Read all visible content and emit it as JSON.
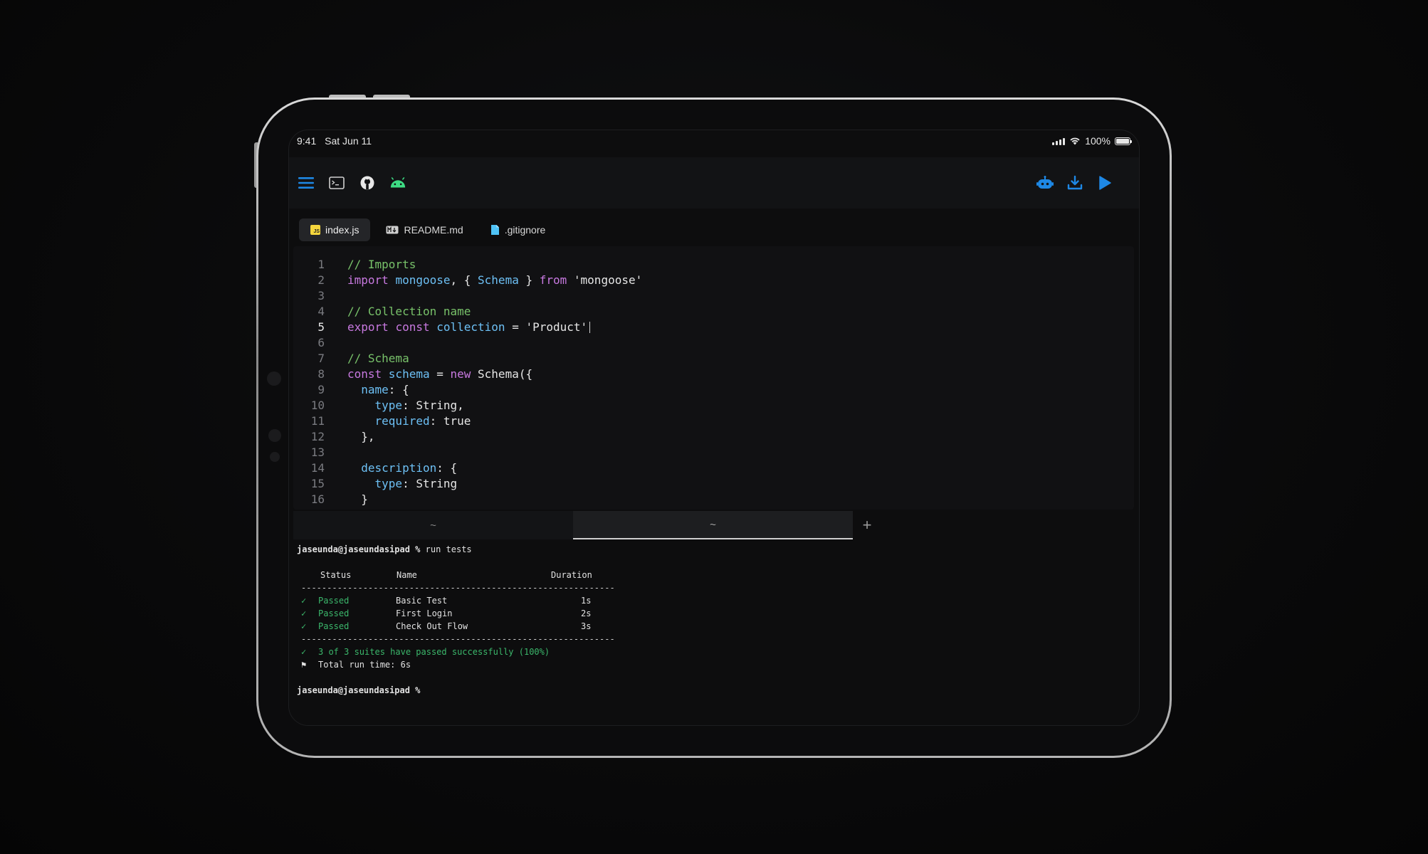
{
  "status_bar": {
    "time": "9:41",
    "date": "Sat Jun 11",
    "battery": "100%"
  },
  "toolbar": {
    "left_icons": [
      "menu-icon",
      "terminal-icon",
      "github-icon",
      "android-icon"
    ],
    "right_icons": [
      "robot-icon",
      "download-icon",
      "play-icon"
    ],
    "accent": "#1e88e5",
    "android_color": "#3ddc84"
  },
  "tabs": [
    {
      "label": "index.js",
      "icon": "js-file-icon",
      "active": true
    },
    {
      "label": "README.md",
      "icon": "markdown-file-icon",
      "active": false
    },
    {
      "label": ".gitignore",
      "icon": "file-icon",
      "active": false
    }
  ],
  "editor": {
    "active_line": 5,
    "lines": [
      {
        "n": "1",
        "tokens": [
          [
            "c",
            "// Imports"
          ]
        ]
      },
      {
        "n": "2",
        "tokens": [
          [
            "k",
            "import "
          ],
          [
            "v",
            "mongoose"
          ],
          [
            "p",
            ", { "
          ],
          [
            "v",
            "Schema"
          ],
          [
            "p",
            " } "
          ],
          [
            "k",
            "from "
          ],
          [
            "s",
            "'mongoose'"
          ]
        ]
      },
      {
        "n": "3",
        "tokens": []
      },
      {
        "n": "4",
        "tokens": [
          [
            "c",
            "// Collection name"
          ]
        ]
      },
      {
        "n": "5",
        "tokens": [
          [
            "k",
            "export "
          ],
          [
            "k",
            "const "
          ],
          [
            "v",
            "collection"
          ],
          [
            "p",
            " = "
          ],
          [
            "s",
            "'Product'"
          ]
        ]
      },
      {
        "n": "6",
        "tokens": []
      },
      {
        "n": "7",
        "tokens": [
          [
            "c",
            "// Schema"
          ]
        ]
      },
      {
        "n": "8",
        "tokens": [
          [
            "k",
            "const "
          ],
          [
            "v",
            "schema"
          ],
          [
            "p",
            " = "
          ],
          [
            "k",
            "new "
          ],
          [
            "p",
            "Schema({"
          ]
        ]
      },
      {
        "n": "9",
        "tokens": [
          [
            "p",
            "  "
          ],
          [
            "v",
            "name"
          ],
          [
            "p",
            ": {"
          ]
        ]
      },
      {
        "n": "10",
        "tokens": [
          [
            "p",
            "    "
          ],
          [
            "v",
            "type"
          ],
          [
            "p",
            ": String,"
          ]
        ]
      },
      {
        "n": "11",
        "tokens": [
          [
            "p",
            "    "
          ],
          [
            "v",
            "required"
          ],
          [
            "p",
            ": true"
          ]
        ]
      },
      {
        "n": "12",
        "tokens": [
          [
            "p",
            "  },"
          ]
        ]
      },
      {
        "n": "13",
        "tokens": []
      },
      {
        "n": "14",
        "tokens": [
          [
            "p",
            "  "
          ],
          [
            "v",
            "description"
          ],
          [
            "p",
            ": {"
          ]
        ]
      },
      {
        "n": "15",
        "tokens": [
          [
            "p",
            "    "
          ],
          [
            "v",
            "type"
          ],
          [
            "p",
            ": String"
          ]
        ]
      },
      {
        "n": "16",
        "tokens": [
          [
            "p",
            "  }"
          ]
        ]
      }
    ]
  },
  "terminal_tabs": [
    {
      "label": "~",
      "active": false
    },
    {
      "label": "~",
      "active": true
    }
  ],
  "terminal_add": "+",
  "terminal": {
    "prompt": "jaseunda@jaseundasipad %",
    "command": "run tests",
    "headers": {
      "status": "Status",
      "name": "Name",
      "duration": "Duration"
    },
    "separator": "-------------------------------------------------------------",
    "check": "✓",
    "flag": "⚑",
    "results": [
      {
        "status": "Passed",
        "name": "Basic Test",
        "duration": "1s"
      },
      {
        "status": "Passed",
        "name": "First Login",
        "duration": "2s"
      },
      {
        "status": "Passed",
        "name": "Check Out Flow",
        "duration": "3s"
      }
    ],
    "summary": "3 of 3 suites have passed successfully (100%)",
    "runtime": "Total run time: 6s"
  }
}
